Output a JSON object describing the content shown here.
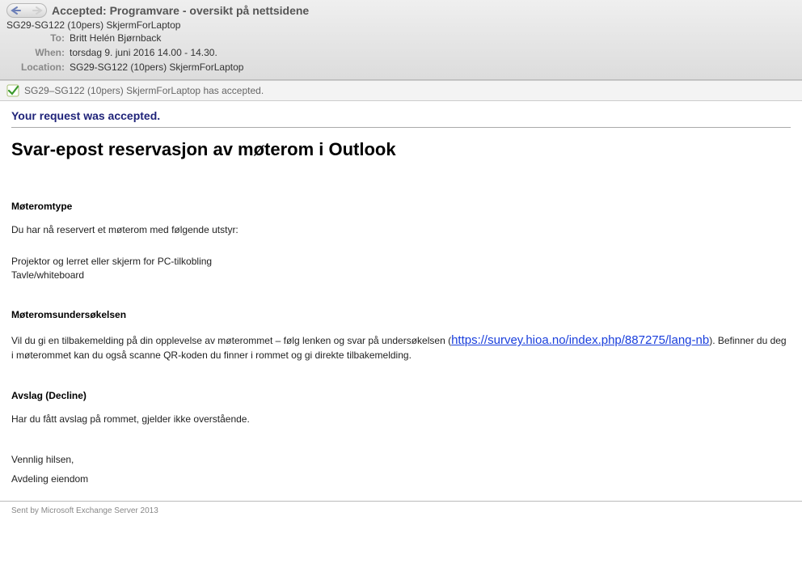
{
  "header": {
    "subject": "Accepted: Programvare - oversikt på nettsidene",
    "from": "SG29-SG122 (10pers) SkjermForLaptop",
    "to_label": "To:",
    "to": "Britt Helén Bjørnback",
    "when_label": "When:",
    "when": "torsdag 9. juni 2016 14.00 - 14.30.",
    "location_label": "Location:",
    "location": "SG29-SG122 (10pers) SkjermForLaptop"
  },
  "accepted_bar": "SG29–SG122 (10pers) SkjermForLaptop has accepted.",
  "body": {
    "accepted_msg": "Your request was accepted.",
    "title": "Svar-epost reservasjon av møterom i Outlook",
    "section_roomtype": "Møteromtype",
    "roomtype_intro": "Du har nå reservert et møterom med følgende utstyr:",
    "equipment1": "Projektor og lerret  eller skjerm for PC-tilkobling",
    "equipment2": "Tavle/whiteboard",
    "section_survey": "Møteromsundersøkelsen",
    "survey_pre": "Vil du gi en tilbakemelding på din opplevelse av møterommet – følg lenken og svar på undersøkelsen (",
    "survey_link": "https://survey.hioa.no/index.php/887275/lang-nb",
    "survey_post": "). Befinner du deg i møterommet kan du også scanne QR-koden du finner i rommet og gi direkte tilbakemelding.",
    "section_decline": "Avslag (Decline)",
    "decline_text": "Har du fått avslag på rommet, gjelder ikke overstående.",
    "closing1": "Vennlig hilsen,",
    "closing2": "Avdeling eiendom"
  },
  "footer": "Sent by Microsoft Exchange Server 2013"
}
